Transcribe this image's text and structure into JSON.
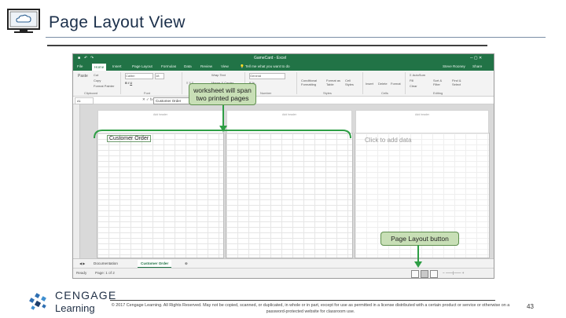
{
  "slide": {
    "title": "Page Layout View",
    "page_number": "43",
    "copyright": "© 2017 Cengage Learning. All Rights Reserved. May not be copied, scanned, or duplicated, in whole or in part, except for use as permitted in a license distributed with a certain product or service or otherwise on a password-protected website for classroom use.",
    "brand_top": "CENGAGE",
    "brand_bottom": "Learning"
  },
  "excel": {
    "window_title": "GameCard - Excel",
    "tell_me": "Tell me what you want to do",
    "user": "Steve Rooney",
    "share": "Share",
    "menu": [
      "File",
      "Home",
      "Insert",
      "Page Layout",
      "Formulas",
      "Data",
      "Review",
      "View"
    ],
    "ribbon_groups": [
      "Clipboard",
      "Font",
      "Alignment",
      "Number",
      "Styles",
      "Cells",
      "Editing"
    ],
    "ribbon_items": {
      "paste": "Paste",
      "cut": "Cut",
      "copy": "Copy",
      "format_painter": "Format Painter",
      "font_name": "Calibri",
      "font_size": "18",
      "wrap_text": "Wrap Text",
      "merge_center": "Merge & Center",
      "number_format": "General",
      "conditional_formatting": "Conditional Formatting",
      "format_as_table": "Format as Table",
      "cell_styles": "Cell Styles",
      "insert": "Insert",
      "delete": "Delete",
      "format": "Format",
      "autosum": "AutoSum",
      "fill": "Fill",
      "clear": "Clear",
      "sort_filter": "Sort & Filter",
      "find_select": "Find & Select"
    },
    "name_box": "A1",
    "formula_value": "Customer Order",
    "pages": [
      {
        "header_label": "Add header",
        "content": "Customer Order"
      },
      {
        "header_label": "Add header",
        "content": ""
      },
      {
        "header_label": "Add header",
        "content": "Click to add data"
      }
    ],
    "sheet_tabs": [
      "Documentation",
      "Customer Order"
    ],
    "active_tab": "Customer Order",
    "status": "Ready",
    "page_indicator": "Page: 1 of 2"
  },
  "callouts": {
    "span": "worksheet will span two printed pages",
    "button": "Page Layout button"
  },
  "colors": {
    "excel_green": "#217346",
    "callout_fill": "#c8dfb6",
    "arrow": "#2e9e45"
  }
}
